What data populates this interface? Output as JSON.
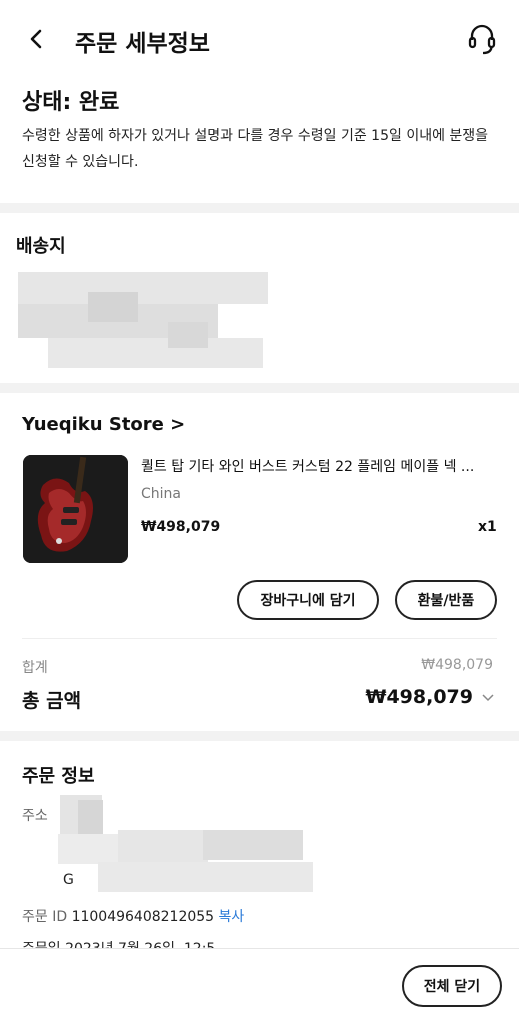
{
  "header": {
    "title": "주문 세부정보",
    "back_icon": "chevron-left-icon",
    "support_icon": "headset-icon"
  },
  "status": {
    "title": "상태: 완료",
    "description": "수령한 상품에 하자가 있거나 설명과 다를 경우 수령일 기준 15일 이내에 분쟁을 신청할 수 있습니다."
  },
  "shipping": {
    "title": "배송지"
  },
  "store": {
    "name": "Yueqiku Store >"
  },
  "product": {
    "name": "퀼트 탑 기타 와인 버스트 커스텀 22 플레임 메이플 넥 ...",
    "origin": "China",
    "price": "₩498,079",
    "qty": "x1"
  },
  "actions": {
    "add_to_cart": "장바구니에 담기",
    "refund": "환불/반품"
  },
  "summary": {
    "subtotal_label": "합계",
    "subtotal_value": "₩498,079",
    "total_label": "총 금액",
    "total_value": "₩498,079"
  },
  "order_info": {
    "title": "주문 정보",
    "address_label": "주소",
    "address_partial": "G",
    "id_label": "주문 ID",
    "id_value": "1100496408212055",
    "copy_label": "복사",
    "date_text": "주문일 2023년 7월 26일, 12:5"
  },
  "footer": {
    "close_all": "전체 닫기"
  },
  "colors": {
    "accent_link": "#2a7ad8",
    "divider": "#f2f2f2"
  }
}
